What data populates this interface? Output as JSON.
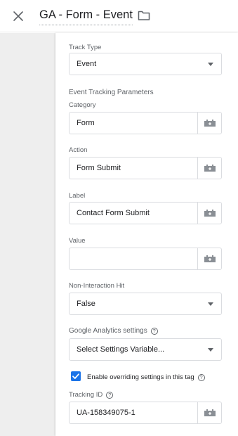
{
  "header": {
    "title": "GA - Form - Event"
  },
  "track_type": {
    "label": "Track Type",
    "value": "Event"
  },
  "event_params": {
    "heading": "Event Tracking Parameters",
    "category": {
      "label": "Category",
      "value": "Form"
    },
    "action": {
      "label": "Action",
      "value": "Form Submit"
    },
    "label": {
      "label": "Label",
      "value": "Contact Form Submit"
    },
    "value": {
      "label": "Value",
      "value": ""
    }
  },
  "non_interaction": {
    "label": "Non-Interaction Hit",
    "value": "False"
  },
  "ga_settings": {
    "label": "Google Analytics settings",
    "value": "Select Settings Variable..."
  },
  "override": {
    "label": "Enable overriding settings in this tag",
    "checked": true
  },
  "tracking_id": {
    "label": "Tracking ID",
    "value": "UA-158349075-1"
  },
  "icons": {
    "close": "close-icon",
    "folder": "folder-icon",
    "variable": "variable-picker-icon",
    "help": "help-icon",
    "caret": "dropdown-caret-icon"
  },
  "colors": {
    "accent": "#1a73e8",
    "border": "#dadce0",
    "side_panel": "#eeeeee"
  }
}
